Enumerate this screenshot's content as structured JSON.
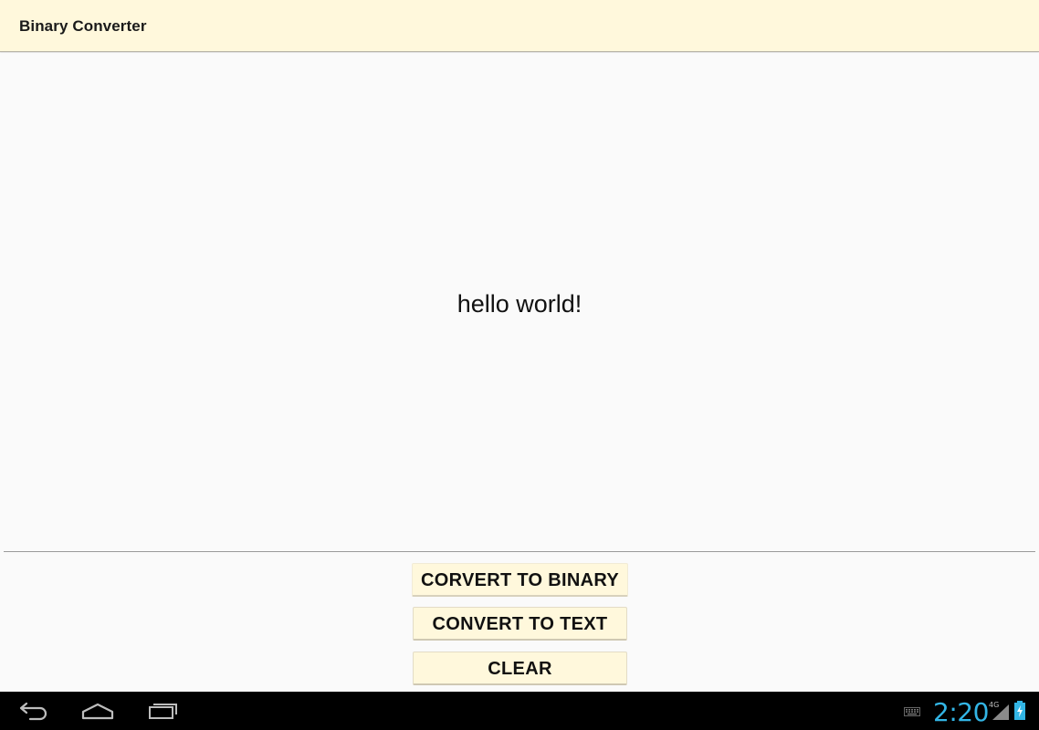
{
  "action_bar": {
    "title": "Binary Converter"
  },
  "main": {
    "output_text": "hello world!"
  },
  "buttons": {
    "convert_to_binary": "CORVERT TO BINARY",
    "convert_to_text": "CONVERT TO TEXT",
    "clear": "CLEAR"
  },
  "system_bar": {
    "clock": "2:20",
    "network": "4G",
    "icons": [
      "back-icon",
      "home-icon",
      "recents-icon",
      "keyboard-icon",
      "signal-icon",
      "battery-charging-icon"
    ],
    "clock_color": "#33b5e5"
  },
  "colors": {
    "action_bar_bg": "#fff8dc",
    "button_bg": "#fff8dc",
    "page_bg": "#fafafa"
  }
}
